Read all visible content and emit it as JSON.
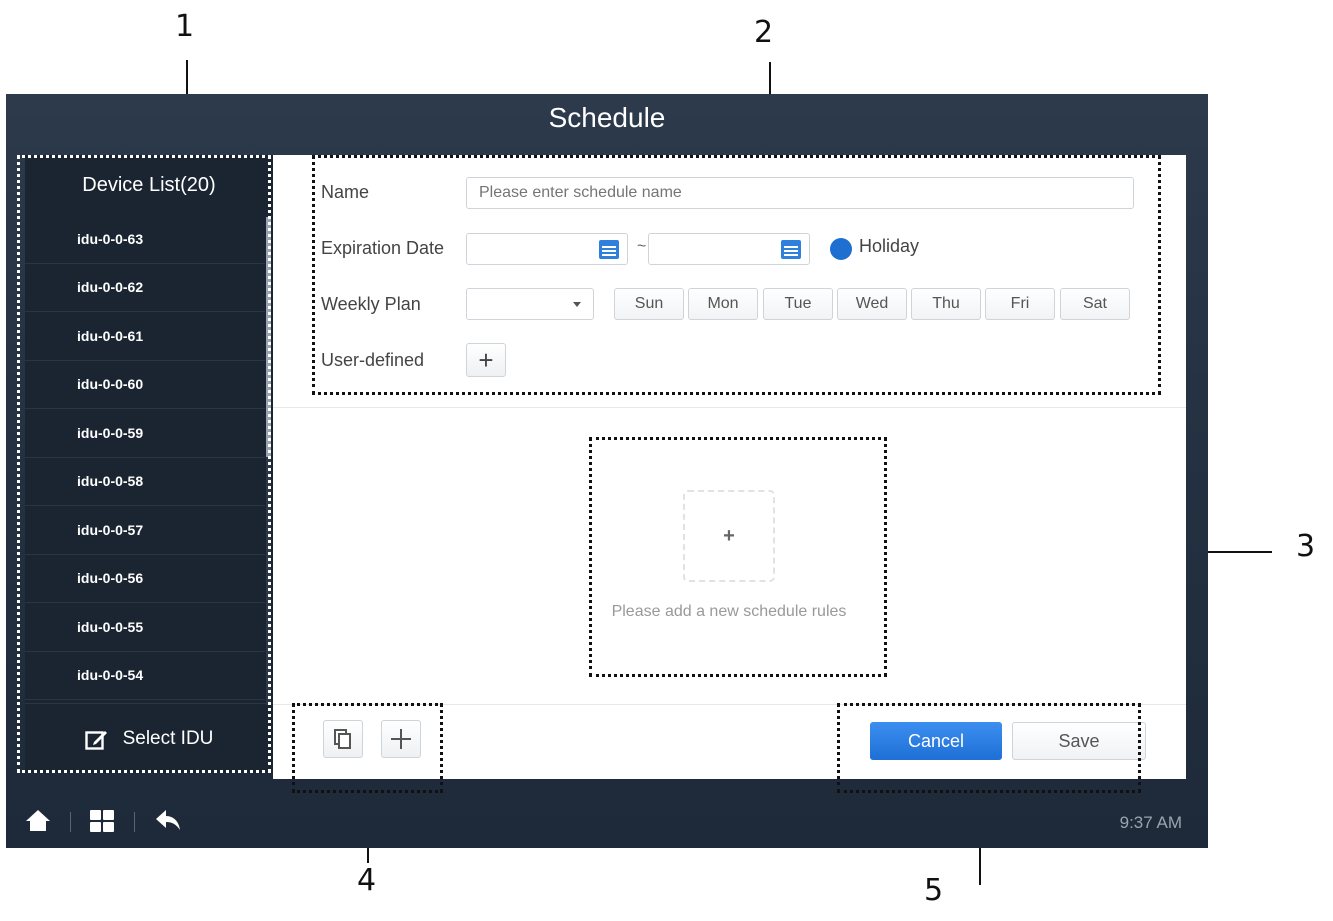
{
  "callouts": [
    "1",
    "2",
    "3",
    "4",
    "5"
  ],
  "window": {
    "title": "Schedule"
  },
  "sidebar": {
    "header": "Device List(20)",
    "devices": [
      "idu-0-0-63",
      "idu-0-0-62",
      "idu-0-0-61",
      "idu-0-0-60",
      "idu-0-0-59",
      "idu-0-0-58",
      "idu-0-0-57",
      "idu-0-0-56",
      "idu-0-0-55",
      "idu-0-0-54"
    ],
    "select_label": "Select IDU",
    "select_icon": "edit-icon"
  },
  "form": {
    "name_label": "Name",
    "name_placeholder": "Please enter schedule name",
    "name_value": "",
    "expiration_label": "Expiration Date",
    "date_separator": "~",
    "holiday_label": "Holiday",
    "weekly_label": "Weekly Plan",
    "weekly_value": "",
    "days": [
      "Sun",
      "Mon",
      "Tue",
      "Wed",
      "Thu",
      "Fri",
      "Sat"
    ],
    "user_defined_label": "User-defined",
    "user_defined_button": "+"
  },
  "rules": {
    "add_symbol": "+",
    "hint": "Please add a new schedule rules"
  },
  "footer": {
    "cancel": "Cancel",
    "save": "Save"
  },
  "statusbar": {
    "time": "9:37 AM"
  },
  "colors": {
    "accent": "#1f6fd1",
    "background": "#243243",
    "sidebar": "#1b2532"
  }
}
